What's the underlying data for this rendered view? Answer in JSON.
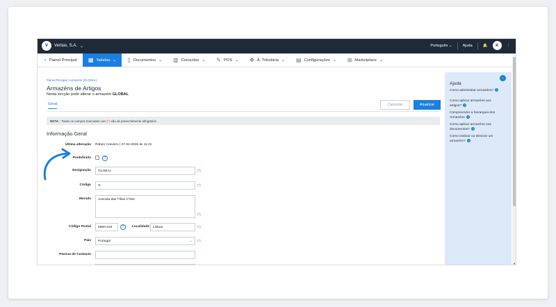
{
  "topbar": {
    "company": "Veritas, S.A.",
    "logo_text": "V",
    "language": "Português",
    "help": "Ajuda",
    "avatar_text": "R"
  },
  "nav": {
    "items": [
      {
        "label": "Painel Principal",
        "icon": "dashboard-icon"
      },
      {
        "label": "Tabelas",
        "icon": "tables-icon",
        "active": true
      },
      {
        "label": "Documentos",
        "icon": "document-icon"
      },
      {
        "label": "Consultas",
        "icon": "chart-icon"
      },
      {
        "label": "POS",
        "icon": "pos-icon"
      },
      {
        "label": "A. Tributária",
        "icon": "tax-icon"
      },
      {
        "label": "Configurações",
        "icon": "settings-icon"
      },
      {
        "label": "Marketplace",
        "icon": "marketplace-icon"
      }
    ]
  },
  "page": {
    "breadcrumb": {
      "root": "Painel Principal",
      "sep": "/",
      "current": "Armazém (GLOBAL)"
    },
    "title": "Armazéns de Artigos",
    "subtitle_prefix": "Nesta secção pode alterar o armazém",
    "subtitle_bold": "GLOBAL",
    "tab": "Geral",
    "cancel": "Cancelar",
    "update": "Atualizar",
    "note_label": "NOTA",
    "note_pre": ": Todos os campos marcados com",
    "note_mark": "(*)",
    "note_post": "são de preenchimento obrigatório",
    "section": "Informação Geral"
  },
  "form": {
    "last_change_label": "Última alteração",
    "last_change_value": "Rúben Craveiro | 27-04-2026 às 11:21",
    "default_label": "Predefinido",
    "designation_label": "Designação",
    "designation_value": "GLOBAL",
    "code_label": "Código",
    "code_value": "G",
    "address_label": "Morada",
    "address_value": "Avenida das Tílias nº262",
    "postal_label": "Código Postal",
    "postal_value": "4960-225",
    "locality_label": "Localidade",
    "locality_value": "Lisboa",
    "country_label": "País",
    "country_value": "Portugal",
    "contact_label": "Pessoa de Contacto",
    "contact_value": "",
    "required_mark": "(*)",
    "help_mark": "?"
  },
  "help": {
    "title": "Ajuda",
    "links": [
      "Como administrar armazéns?",
      "Como aplicar armazéns aos artigos?",
      "Compreender a hierarquia dos Armazéns",
      "Como aplicar armazéns nos documentos?",
      "Como inativar ou eliminar um armazém?"
    ]
  },
  "colors": {
    "accent": "#1a7fe0",
    "topbar": "#1f2a38",
    "help_panel": "#dce9f8",
    "required": "#e03b3b"
  }
}
